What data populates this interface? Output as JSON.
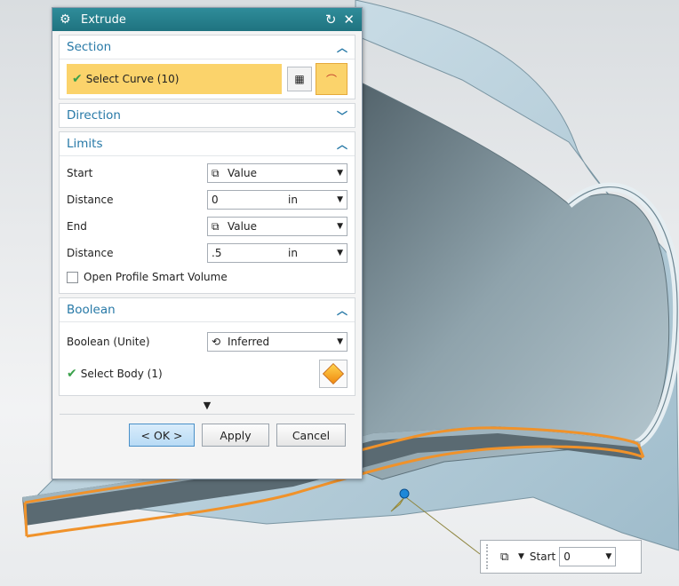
{
  "dialog": {
    "title": "Extrude",
    "section": {
      "title": "Section",
      "select_curve_label": "Select Curve (10)"
    },
    "direction": {
      "title": "Direction"
    },
    "limits": {
      "title": "Limits",
      "start_label": "Start",
      "start_value": "Value",
      "start_distance_label": "Distance",
      "start_distance_value": "0",
      "start_distance_unit": "in",
      "end_label": "End",
      "end_value": "Value",
      "end_distance_label": "Distance",
      "end_distance_value": ".5",
      "end_distance_unit": "in",
      "open_profile_label": "Open Profile Smart Volume",
      "open_profile_checked": false
    },
    "boolean": {
      "title": "Boolean",
      "boolean_label": "Boolean (Unite)",
      "boolean_value": "Inferred",
      "select_body_label": "Select Body (1)"
    },
    "buttons": {
      "ok": "< OK >",
      "apply": "Apply",
      "cancel": "Cancel"
    }
  },
  "mini_toolbar": {
    "label": "Start",
    "value": "0"
  },
  "colors": {
    "title_bar": "#1f7380",
    "section_header": "#2779a7",
    "selection_highlight": "#fbd36b",
    "edge_highlight": "#f0922a",
    "model_face": "#b9d1dc"
  }
}
